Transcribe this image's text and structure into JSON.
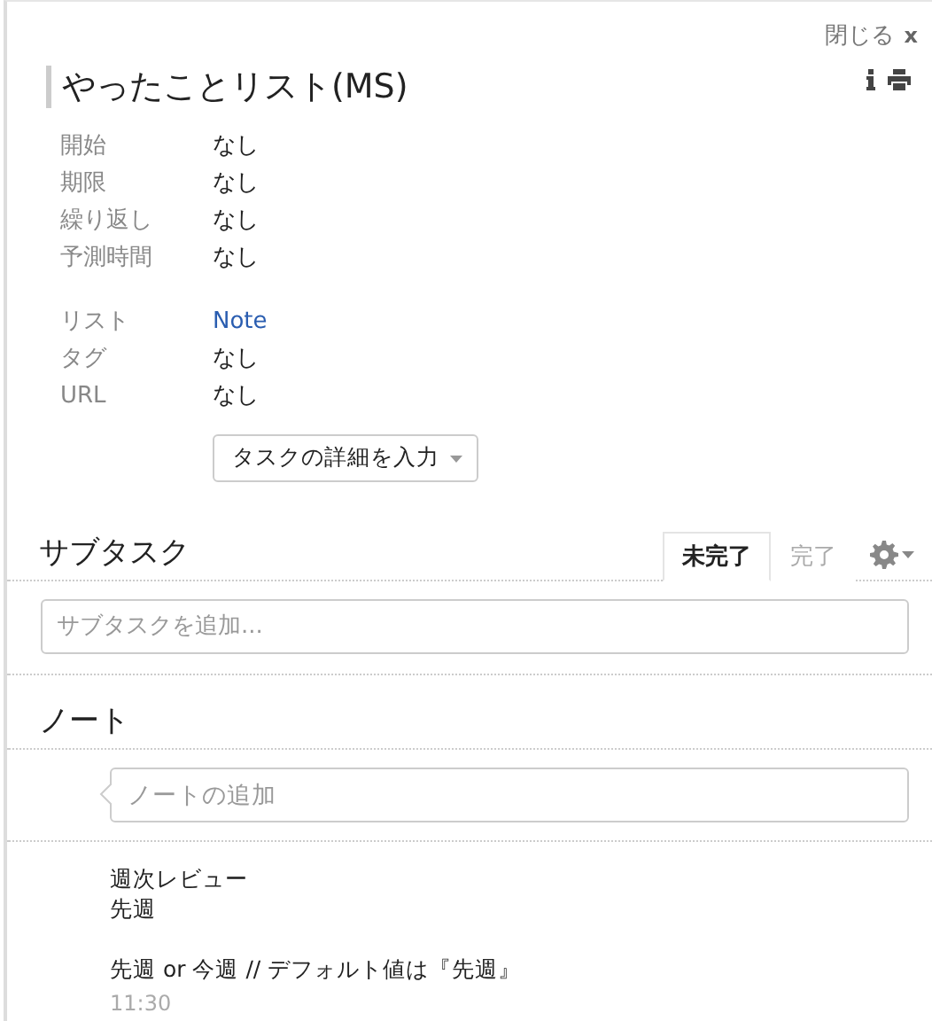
{
  "close": {
    "label": "閉じる",
    "icon": "x"
  },
  "title": "やったことリスト(MS)",
  "fields_schedule": [
    {
      "label": "開始",
      "value": "なし",
      "kind": "text"
    },
    {
      "label": "期限",
      "value": "なし",
      "kind": "text"
    },
    {
      "label": "繰り返し",
      "value": "なし",
      "kind": "text"
    },
    {
      "label": "予測時間",
      "value": "なし",
      "kind": "text"
    }
  ],
  "fields_meta": [
    {
      "label": "リスト",
      "value": "Note",
      "kind": "link"
    },
    {
      "label": "タグ",
      "value": "なし",
      "kind": "text"
    },
    {
      "label": "URL",
      "value": "なし",
      "kind": "text"
    }
  ],
  "details_button": "タスクの詳細を入力",
  "subtasks": {
    "title": "サブタスク",
    "tabs": [
      {
        "label": "未完了",
        "selected": true
      },
      {
        "label": "完了",
        "selected": false
      }
    ],
    "placeholder": "サブタスクを追加..."
  },
  "notes": {
    "title": "ノート",
    "placeholder": "ノートの追加",
    "items": [
      {
        "paragraphs": [
          [
            "週次レビュー",
            "先週"
          ],
          [
            "先週 or 今週 // デフォルト値は『先週』"
          ]
        ],
        "time": "11:30"
      }
    ]
  }
}
